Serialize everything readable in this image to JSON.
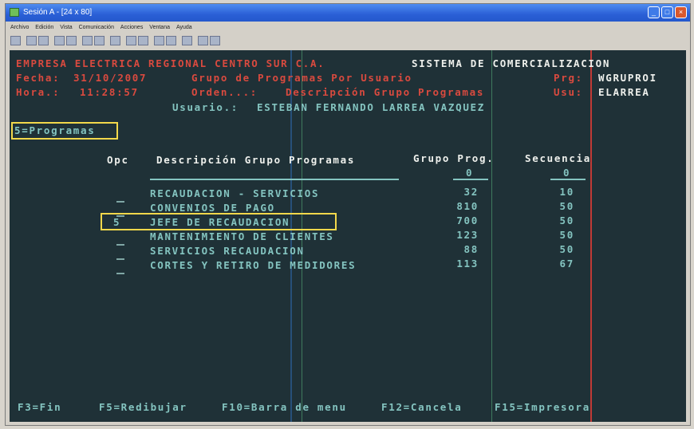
{
  "window": {
    "title": "Sesión A - [24 x 80]",
    "menu": [
      "Archivo",
      "Edición",
      "Vista",
      "Comunicación",
      "Acciones",
      "Ventana",
      "Ayuda"
    ]
  },
  "header": {
    "company": "EMPRESA ELECTRICA REGIONAL CENTRO SUR C.A.",
    "system": "SISTEMA DE COMERCIALIZACION",
    "fecha_label": "Fecha:",
    "fecha_value": "31/10/2007",
    "screen_title": "Grupo de Programas Por Usuario",
    "prg_label": "Prg:",
    "prg_value": "WGRUPROI",
    "hora_label": "Hora.:",
    "hora_value": "11:28:57",
    "orden_label": "Orden...:",
    "orden_value": "Descripción Grupo Programas",
    "usu_label": "Usu:",
    "usu_value": "ELARREA",
    "usuario_label": "Usuario.:",
    "usuario_value": "ESTEBAN FERNANDO LARREA VAZQUEZ"
  },
  "options_hint": "5=Programas",
  "table": {
    "columns": {
      "opc": "Opc",
      "descripcion": "Descripción Grupo Programas",
      "grupo": "Grupo Prog.",
      "secuencia": "Secuencia"
    },
    "position_grupo": "0",
    "position_secuencia": "0",
    "rows": [
      {
        "opc": "",
        "descripcion": "RECAUDACION - SERVICIOS",
        "grupo": "32",
        "secuencia": "10"
      },
      {
        "opc": "",
        "descripcion": "CONVENIOS DE PAGO",
        "grupo": "810",
        "secuencia": "50"
      },
      {
        "opc": "5",
        "descripcion": "JEFE DE RECAUDACION",
        "grupo": "700",
        "secuencia": "50"
      },
      {
        "opc": "",
        "descripcion": "MANTENIMIENTO DE CLIENTES",
        "grupo": "123",
        "secuencia": "50"
      },
      {
        "opc": "",
        "descripcion": "SERVICIOS RECAUDACION",
        "grupo": "88",
        "secuencia": "50"
      },
      {
        "opc": "",
        "descripcion": "CORTES Y RETIRO DE MEDIDORES",
        "grupo": "113",
        "secuencia": "67"
      }
    ]
  },
  "function_keys": {
    "f3": "F3=Fin",
    "f5": "F5=Redibujar",
    "f10": "F10=Barra de menu",
    "f12": "F12=Cancela",
    "f15": "F15=Impresora"
  },
  "colors": {
    "screen_bg": "#1f3137",
    "highlight_box": "#f2d84b",
    "title_red": "#d94a3f",
    "field_cyan": "#84c4c0"
  },
  "icons": [
    "session-icon",
    "minimize-icon",
    "maximize-icon",
    "close-icon"
  ]
}
